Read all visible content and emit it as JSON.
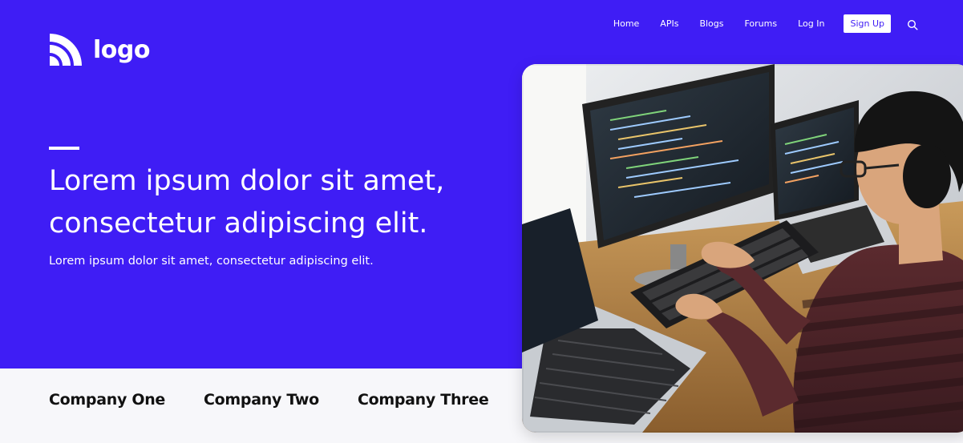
{
  "brand": {
    "name": "logo",
    "icon": "rss-icon"
  },
  "nav": {
    "items": [
      "Home",
      "APIs",
      "Blogs",
      "Forums",
      "Log In"
    ],
    "signup_label": "Sign Up",
    "search_icon": "search-icon"
  },
  "hero": {
    "headline_line1": "Lorem ipsum dolor sit amet,",
    "headline_line2": "consectetur adipiscing elit.",
    "subtitle": "Lorem ipsum dolor sit amet, consectetur adipiscing elit."
  },
  "companies": [
    "Company One",
    "Company Two",
    "Company Three"
  ],
  "colors": {
    "primary": "#3f1df5",
    "band": "#f7f7fa",
    "text_dark": "#111111"
  }
}
